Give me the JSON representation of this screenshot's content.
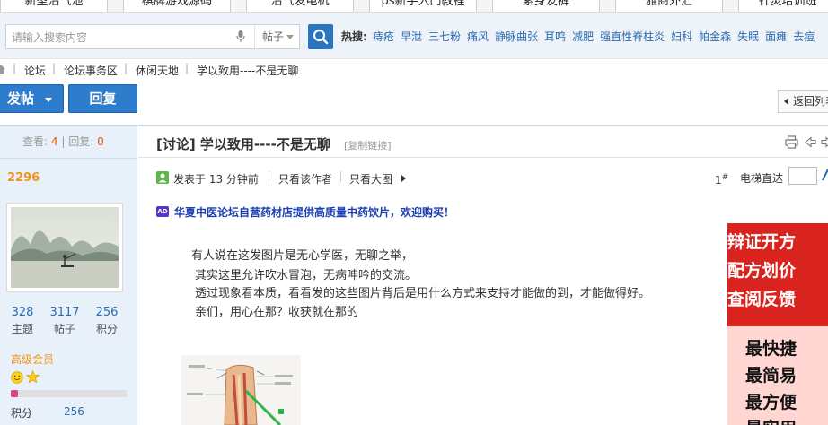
{
  "ad_strip": [
    "新型沼气池",
    "棋牌游戏源码",
    "沼气发电机",
    "ps新手入门教程",
    "素身友裤",
    "雅商外汇",
    "针灸培训班"
  ],
  "search": {
    "placeholder": "请输入搜索内容",
    "scope": "帖子",
    "hot_label": "热搜:",
    "hot_terms": [
      "痔疮",
      "早泄",
      "三七粉",
      "痛风",
      "静脉曲张",
      "耳鸣",
      "减肥",
      "强直性脊柱炎",
      "妇科",
      "帕金森",
      "失眠",
      "面瘫",
      "去痘"
    ]
  },
  "breadcrumb": [
    "论坛",
    "论坛事务区",
    "休闲天地",
    "学以致用----不是无聊"
  ],
  "actions": {
    "post_label": "发帖",
    "reply_label": "回复",
    "back_label": "返回列表"
  },
  "thread_stats": {
    "views_label": "查看:",
    "views": "4",
    "sep": "|",
    "replies_label": "回复:",
    "replies": "0"
  },
  "user": {
    "uid": "2296",
    "stats": [
      {
        "value": "328",
        "label": "主题"
      },
      {
        "value": "3117",
        "label": "帖子"
      },
      {
        "value": "256",
        "label": "积分"
      }
    ],
    "rank": "高级会员",
    "level_progress": 0.06,
    "points_label": "积分",
    "points_value": "256"
  },
  "post": {
    "title": "[讨论] 学以致用----不是无聊",
    "copy_link": "[复制链接]",
    "posted": "发表于 13 分钟前",
    "only_author": "只看该作者",
    "big_image": "只看大图",
    "floor": "1",
    "floor_mark": "#",
    "jump_label": "电梯直达",
    "promo_badge": "AD",
    "promo": "华夏中医论坛自营药材店提供高质量中药饮片，欢迎购买！",
    "body": [
      "有人说在这发图片是无心学医，无聊之举，",
      "其实这里允许吹水冒泡，无病呻吟的交流。",
      "透过现象看本质，看看发的这些图片背后是用什么方式来支持才能做的到，才能做得好。",
      "亲们，用心在那？收获就在那的"
    ]
  },
  "side_ad": {
    "top_lines": [
      "辩证开方",
      "配方划价",
      "查阅反馈"
    ],
    "bottom_lines": [
      "最快捷",
      "最简易",
      "最方便",
      "最实用"
    ]
  },
  "colors": {
    "accent_blue": "#2e7ccc",
    "link_blue": "#2b6bb0",
    "orange": "#f2941c",
    "ad_red": "#d9231f"
  }
}
